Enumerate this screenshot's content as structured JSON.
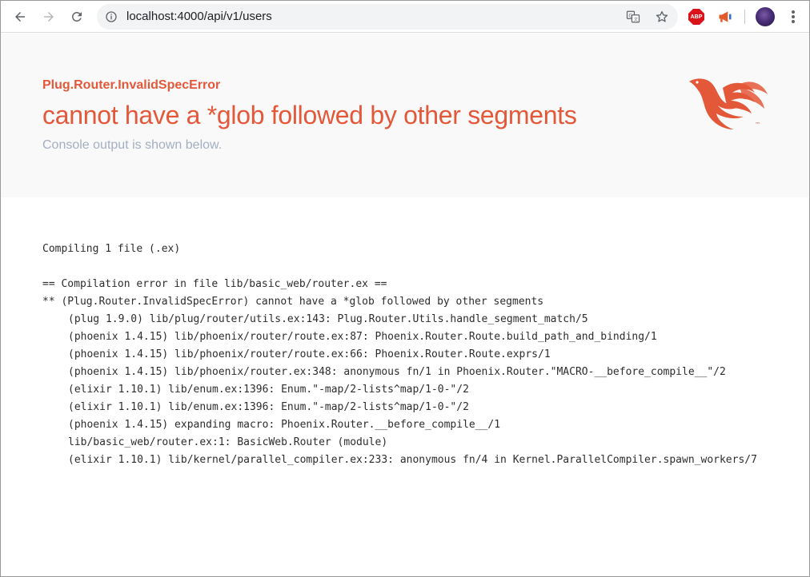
{
  "browser": {
    "url": "localhost:4000/api/v1/users",
    "extensions": {
      "abp_label": "ABP"
    }
  },
  "error": {
    "exception": "Plug.Router.InvalidSpecError",
    "message": "cannot have a *glob followed by other segments",
    "subtitle": "Console output is shown below."
  },
  "console": {
    "lines": [
      "Compiling 1 file (.ex)",
      "",
      "== Compilation error in file lib/basic_web/router.ex ==",
      "** (Plug.Router.InvalidSpecError) cannot have a *glob followed by other segments",
      "(plug 1.9.0) lib/plug/router/utils.ex:143: Plug.Router.Utils.handle_segment_match/5",
      "(phoenix 1.4.15) lib/phoenix/router/route.ex:87: Phoenix.Router.Route.build_path_and_binding/1",
      "(phoenix 1.4.15) lib/phoenix/router/route.ex:66: Phoenix.Router.Route.exprs/1",
      "(phoenix 1.4.15) lib/phoenix/router.ex:348: anonymous fn/1 in Phoenix.Router.\"MACRO-__before_compile__\"/2",
      "(elixir 1.10.1) lib/enum.ex:1396: Enum.\"-map/2-lists^map/1-0-\"/2",
      "(elixir 1.10.1) lib/enum.ex:1396: Enum.\"-map/2-lists^map/1-0-\"/2",
      "(phoenix 1.4.15) expanding macro: Phoenix.Router.__before_compile__/1",
      "lib/basic_web/router.ex:1: BasicWeb.Router (module)",
      "(elixir 1.10.1) lib/kernel/parallel_compiler.ex:233: anonymous fn/4 in Kernel.ParallelCompiler.spawn_workers/7"
    ]
  },
  "colors": {
    "accent": "#e4583a",
    "subtitle": "#a3afc0",
    "banner_bg": "#f9f9fa"
  },
  "icons": [
    "back-arrow-icon",
    "forward-arrow-icon",
    "reload-icon",
    "info-icon",
    "translate-icon",
    "star-icon",
    "abp-icon",
    "megaphone-icon",
    "avatar",
    "more-vert-icon",
    "phoenix-logo"
  ]
}
